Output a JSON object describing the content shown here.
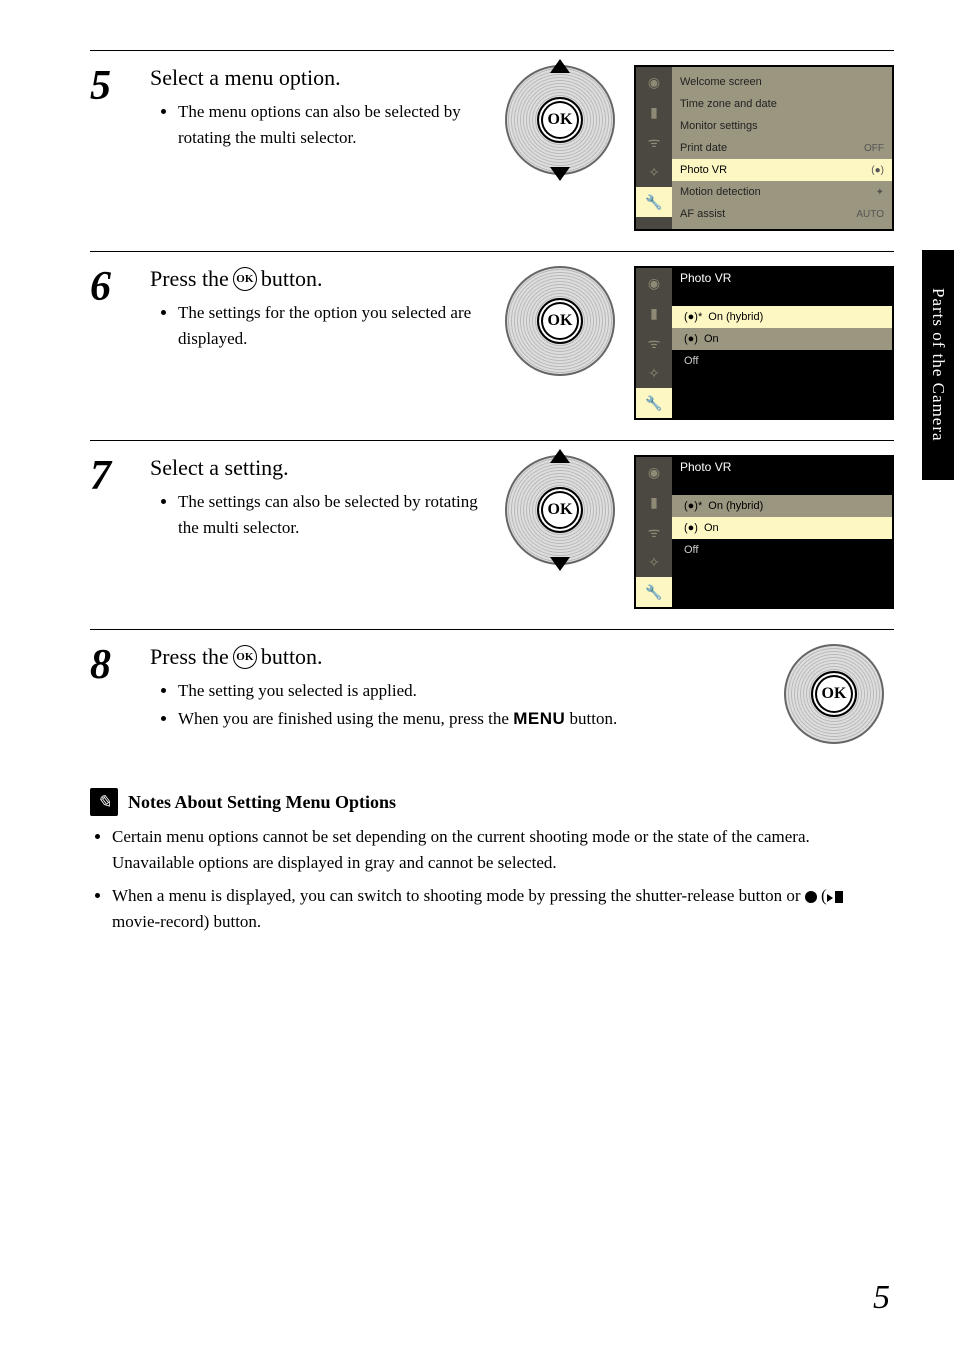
{
  "side_tab": "Parts of the Camera",
  "page_number": "5",
  "steps": {
    "s5": {
      "num": "5",
      "title": "Select a menu option.",
      "bullet": "The menu options can also be selected by rotating the multi selector.",
      "screen": {
        "rows": [
          {
            "label": "Welcome screen",
            "val": ""
          },
          {
            "label": "Time zone and date",
            "val": ""
          },
          {
            "label": "Monitor settings",
            "val": ""
          },
          {
            "label": "Print date",
            "val": "OFF"
          },
          {
            "label": "Photo VR",
            "val": "(●)",
            "hl": true
          },
          {
            "label": "Motion detection",
            "val": "✦"
          },
          {
            "label": "AF assist",
            "val": "AUTO"
          }
        ]
      }
    },
    "s6": {
      "num": "6",
      "title_a": "Press the ",
      "title_b": " button.",
      "bullet": "The settings for the option you selected are displayed.",
      "screen": {
        "title": "Photo VR",
        "options": [
          {
            "label": "On (hybrid)",
            "sel": true,
            "ic": "(●)*"
          },
          {
            "label": "On",
            "ic": "(●)"
          },
          {
            "label": "Off"
          }
        ]
      }
    },
    "s7": {
      "num": "7",
      "title": "Select a setting.",
      "bullet": "The settings can also be selected by rotating the multi selector.",
      "screen": {
        "title": "Photo VR",
        "options": [
          {
            "label": "On (hybrid)",
            "ic": "(●)*"
          },
          {
            "label": "On",
            "sel": true,
            "ic": "(●)"
          },
          {
            "label": "Off"
          }
        ]
      }
    },
    "s8": {
      "num": "8",
      "title_a": "Press the ",
      "title_b": " button.",
      "bullets": [
        "The setting you selected is applied.",
        {
          "pre": "When you are finished using the menu, press the ",
          "menu": "MENU",
          "post": " button."
        }
      ]
    }
  },
  "notes": {
    "title": "Notes About Setting Menu Options",
    "items": [
      "Certain menu options cannot be set depending on the current shooting mode or the state of the camera. Unavailable options are displayed in gray and cannot be selected.",
      {
        "pre": "When a menu is displayed, you can switch to shooting mode by pressing the shutter-release button or ",
        "post": " movie-record) button."
      }
    ]
  }
}
